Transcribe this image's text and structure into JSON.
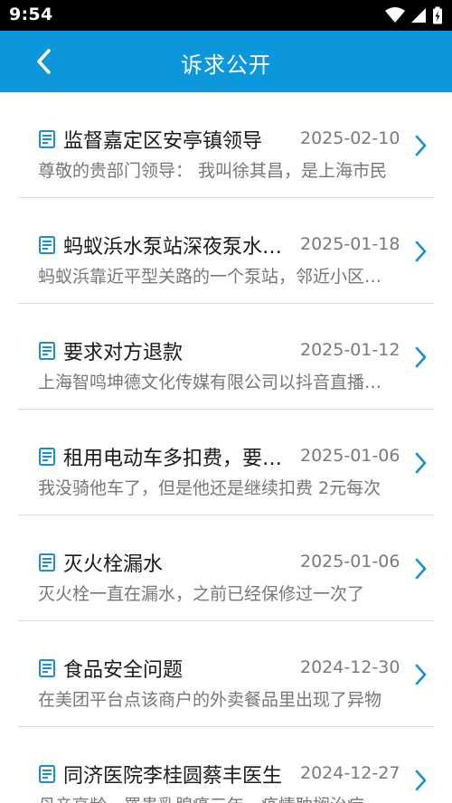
{
  "status_bar": {
    "time": "9:54"
  },
  "header": {
    "title": "诉求公开"
  },
  "items": [
    {
      "title": "监督嘉定区安亭镇领导",
      "date": "2025-02-10",
      "summary": "尊敬的贵部门领导：   我叫徐其昌，是上海市民"
    },
    {
      "title": "蚂蚁浜水泵站深夜泵水噪音",
      "date": "2025-01-18",
      "summary": "蚂蚁浜靠近平型关路的一个泵站，邻近小区居民"
    },
    {
      "title": "要求对方退款",
      "date": "2025-01-12",
      "summary": "上海智鸣坤德文化传媒有限公司以抖音直播为名"
    },
    {
      "title": "租用电动车多扣费，要求退款",
      "date": "2025-01-06",
      "summary": "我没骑他车了，但是他还是继续扣费 2元每次"
    },
    {
      "title": "灭火栓漏水",
      "date": "2025-01-06",
      "summary": "灭火栓一直在漏水，之前已经保修过一次了"
    },
    {
      "title": "食品安全问题",
      "date": "2024-12-30",
      "summary": "在美团平台点该商户的外卖餐品里出现了异物"
    },
    {
      "title": "同济医院李桂圆蔡丰医生",
      "date": "2024-12-27",
      "summary": "母亲高龄，罹患乳腺癌三年，疫情耽搁治疗"
    }
  ],
  "colors": {
    "header_bg": "#0c97dd",
    "accent": "#1a8fd6"
  }
}
